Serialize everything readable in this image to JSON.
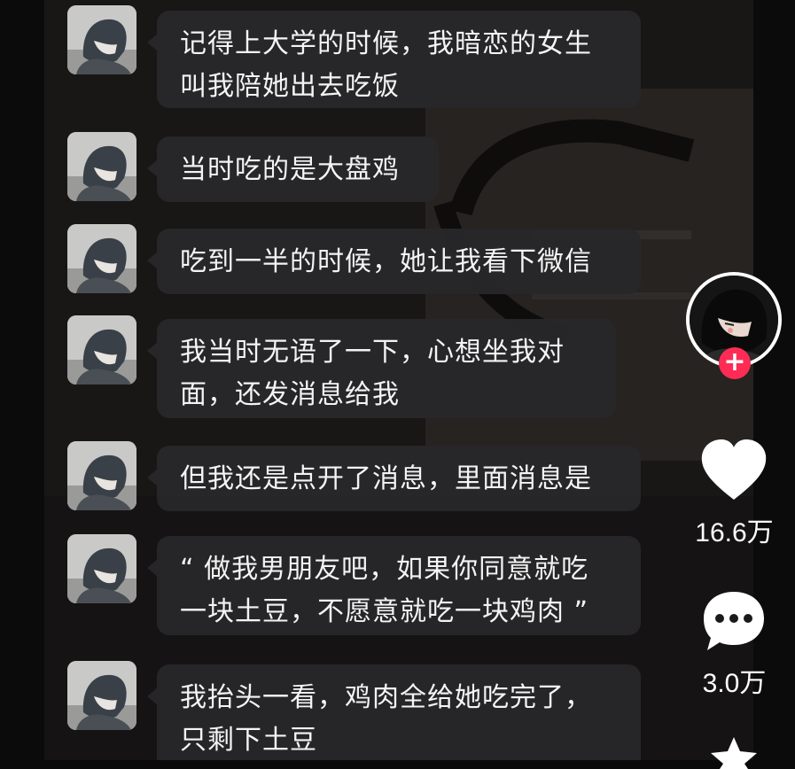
{
  "messages": [
    {
      "text": "记得上大学的时候，我暗恋的女生\n叫我陪她出去吃饭"
    },
    {
      "text": "当时吃的是大盘鸡"
    },
    {
      "text": "吃到一半的时候，她让我看下微信"
    },
    {
      "text": "我当时无语了一下，心想坐我对\n面，还发消息给我"
    },
    {
      "text": "但我还是点开了消息，里面消息是"
    },
    {
      "text": "“ 做我男朋友吧，如果你同意就吃\n一块土豆，不愿意就吃一块鸡肉 ”"
    },
    {
      "text": "我抬头一看，鸡肉全给她吃完了，\n只剩下土豆"
    }
  ],
  "sidebar": {
    "follow_label": "+",
    "like_count": "16.6万",
    "comment_count": "3.0万"
  },
  "colors": {
    "bubble": "#28282a",
    "follow": "#fe2c55",
    "text": "#f4f4f4"
  },
  "icons": [
    "user-avatar-icon",
    "heart-icon",
    "comment-icon",
    "star-icon"
  ]
}
